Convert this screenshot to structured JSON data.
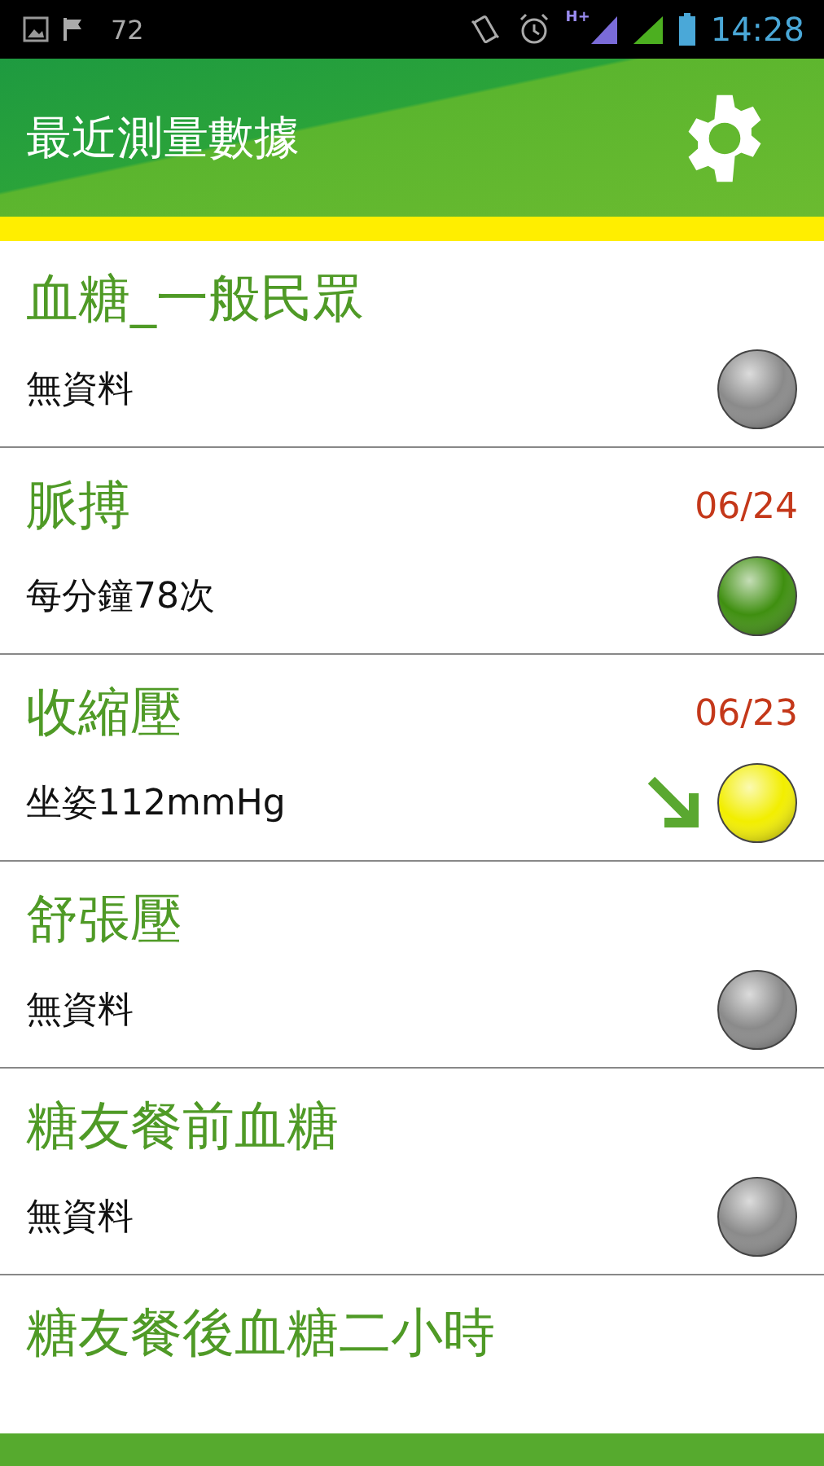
{
  "status_bar": {
    "notification_count": "72",
    "network": "H+",
    "time": "14:28"
  },
  "header": {
    "title": "最近測量數據"
  },
  "measurements": [
    {
      "name": "血糖_一般民眾",
      "reading": "無資料",
      "color": "#8a8a8a",
      "falling": false
    },
    {
      "name": "脈搏",
      "date": "06/24",
      "reading": "每分鐘78次",
      "color": "#3f8f10",
      "falling": false
    },
    {
      "name": "收縮壓",
      "date": "06/23",
      "reading": "坐姿112mmHg",
      "color": "#f2ee00",
      "falling": true
    },
    {
      "name": "舒張壓",
      "reading": "無資料",
      "color": "#8a8a8a",
      "falling": false
    },
    {
      "name": "糖友餐前血糖",
      "reading": "無資料",
      "color": "#8a8a8a",
      "falling": false
    },
    {
      "name": "糖友餐後血糖二小時"
    }
  ]
}
